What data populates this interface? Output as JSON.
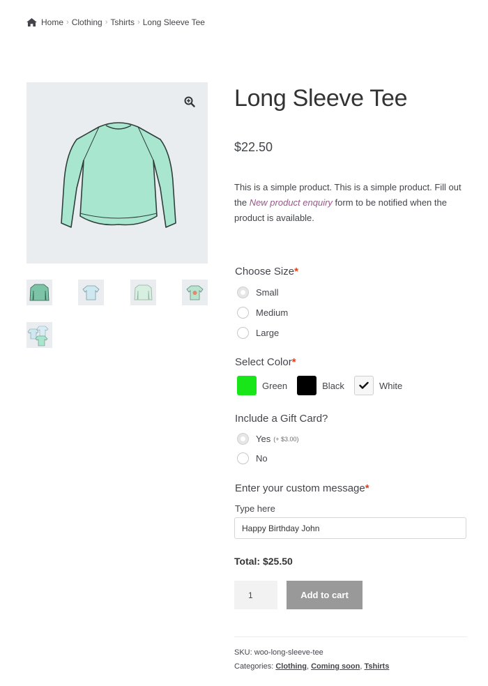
{
  "breadcrumb": {
    "home": "Home",
    "separator": "›",
    "clothing": "Clothing",
    "tshirts": "Tshirts",
    "current": "Long Sleeve Tee"
  },
  "product": {
    "title": "Long Sleeve Tee",
    "price": "$22.50",
    "description_before": "This is a simple product. This is a simple product. Fill out the ",
    "description_link": "New product enquiry",
    "description_after": " form to be notified when the product is available.",
    "image_color": "#a8e6cf"
  },
  "options": {
    "size": {
      "label": "Choose Size",
      "required_mark": "*",
      "choices": [
        "Small",
        "Medium",
        "Large"
      ],
      "selected": "Small"
    },
    "color": {
      "label": "Select Color",
      "required_mark": "*",
      "choices": [
        {
          "name": "Green",
          "hex": "#19e619"
        },
        {
          "name": "Black",
          "hex": "#000000"
        },
        {
          "name": "White",
          "hex": "#f7f7f7",
          "checked": true
        }
      ]
    },
    "gift_card": {
      "label": "Include a Gift Card?",
      "yes": "Yes",
      "yes_price": "(+ $3.00)",
      "no": "No",
      "selected": "Yes"
    },
    "message": {
      "label": "Enter your custom message",
      "required_mark": "*",
      "sublabel": "Type here",
      "value": "Happy Birthday John"
    }
  },
  "cart": {
    "total": "Total: $25.50",
    "quantity": "1",
    "add_label": "Add to cart"
  },
  "meta": {
    "sku_label": "SKU:",
    "sku": "woo-long-sleeve-tee",
    "categories_label": "Categories:",
    "categories": [
      "Clothing",
      "Coming soon",
      "Tshirts"
    ]
  },
  "icons": {
    "home": "home-icon",
    "zoom": "zoom-in-icon",
    "check": "checkmark-icon"
  }
}
